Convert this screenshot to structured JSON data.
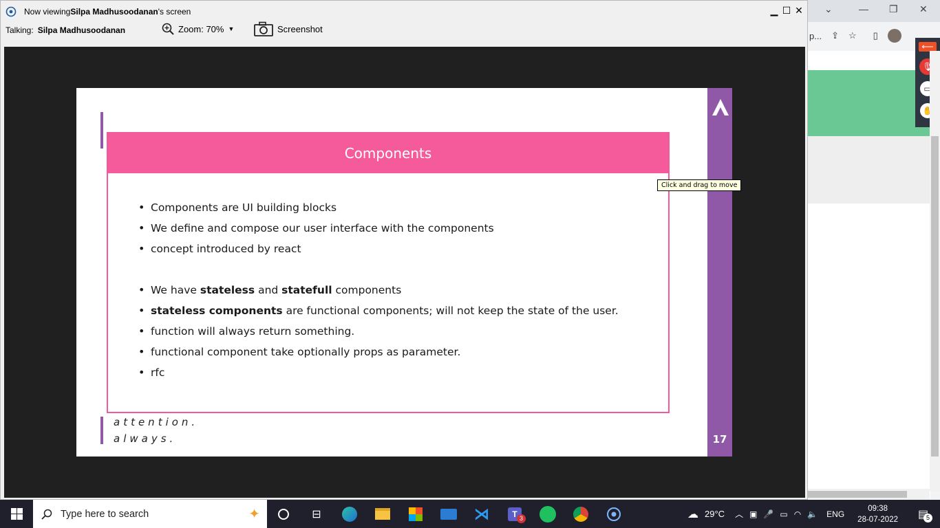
{
  "viewer": {
    "title_prefix": "Now viewing ",
    "title_name": "Silpa Madhusoodanan",
    "title_suffix": "'s screen",
    "talking_label": "Talking:",
    "talking_name": "Silpa Madhusoodanan",
    "zoom_label": "Zoom: 70%",
    "screenshot_label": "Screenshot"
  },
  "slide": {
    "title": "Components",
    "bullets": [
      {
        "pre": "Components are UI building blocks"
      },
      {
        "pre": "We define and compose our user interface with the components"
      },
      {
        "pre": "concept introduced by react"
      },
      {
        "pre": "We have ",
        "b1": "stateless",
        "mid": " and ",
        "b2": "statefull",
        "post": " components"
      },
      {
        "b1": "stateless components",
        "post": " are functional components; will not keep the state of the user."
      },
      {
        "pre": "function will always return something."
      },
      {
        "pre": "functional component take optionally props as parameter."
      },
      {
        "pre": "rfc"
      }
    ],
    "tagline_1": "attention.",
    "tagline_2": "always.",
    "page_number": "17",
    "tooltip": "Click and drag to move"
  },
  "browser": {
    "address_snippet": "p..."
  },
  "taskbar": {
    "search_placeholder": "Type here to search",
    "weather": "29°C",
    "language": "ENG",
    "time": "09:38",
    "date": "28-07-2022",
    "teams_badge": "3",
    "notification_count": "5"
  },
  "colors": {
    "slide_pink": "#f55b9b",
    "slide_purple": "#8f59a8",
    "browser_green": "#69c893",
    "taskbar": "#20202c"
  }
}
